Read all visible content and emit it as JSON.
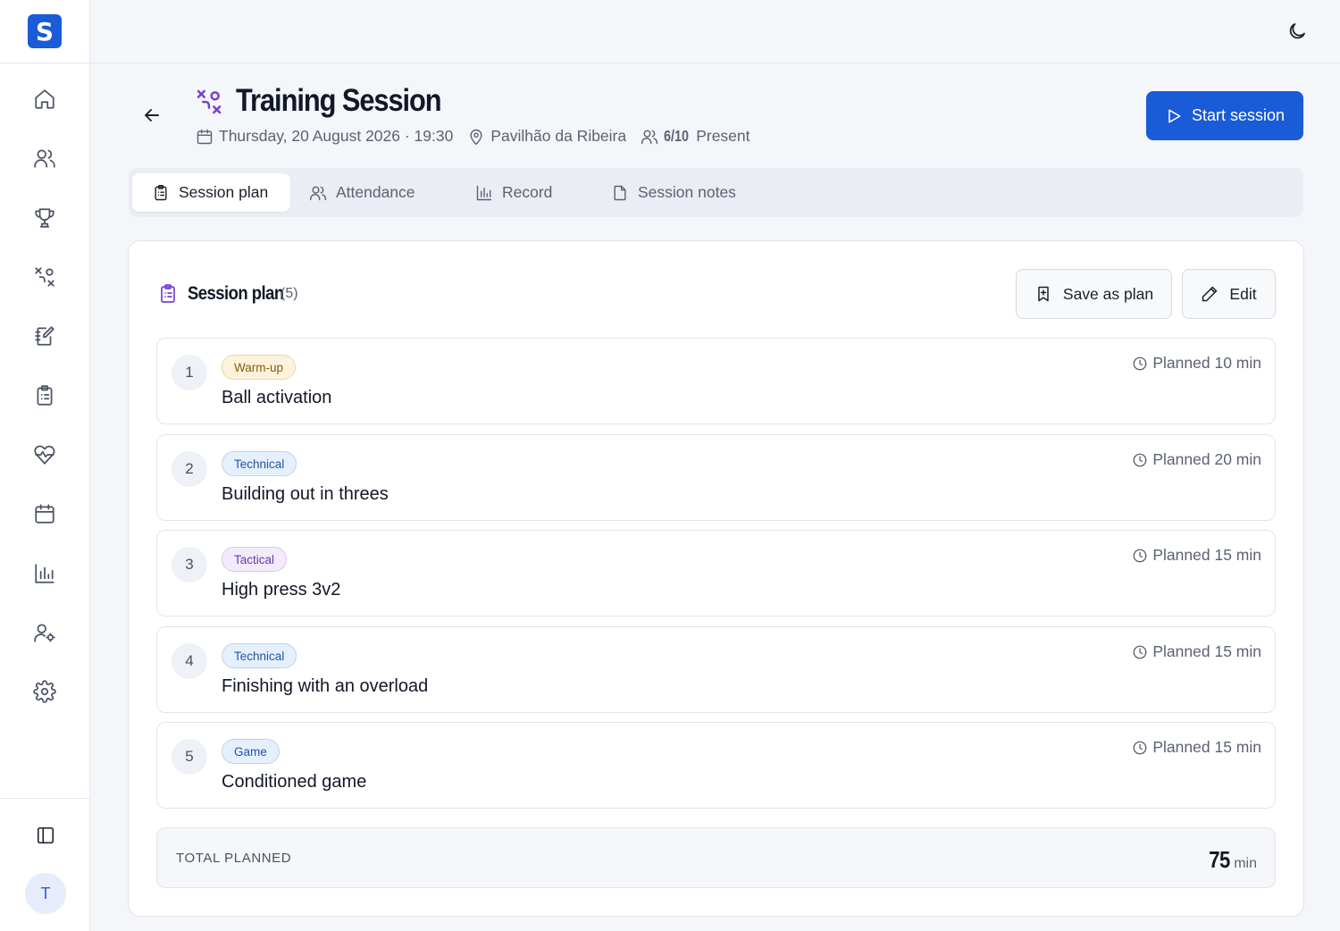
{
  "sidebar": {
    "logo": "S",
    "nav_icons": [
      "home-icon",
      "users-icon",
      "trophy-icon",
      "drills-icon",
      "notebook-icon",
      "clipboard-icon",
      "heart-pulse-icon",
      "calendar-icon",
      "bar-chart-icon",
      "user-settings-icon",
      "gear-icon"
    ],
    "avatar_initial": "T"
  },
  "header": {
    "title": "Training Session",
    "date": "Thursday, 20 August 2026 · 19:30",
    "location": "Pavilhão da Ribeira",
    "attendance_count": "6/10",
    "attendance_label": "Present",
    "start_button": "Start session"
  },
  "tabs": [
    {
      "label": "Session plan",
      "icon": "clipboard-icon",
      "active": true
    },
    {
      "label": "Attendance",
      "icon": "users-icon",
      "active": false
    },
    {
      "label": "Record",
      "icon": "bar-chart-icon",
      "active": false
    },
    {
      "label": "Session notes",
      "icon": "file-icon",
      "active": false
    }
  ],
  "plan": {
    "title": "Session plan",
    "count": "(5)",
    "save_button": "Save as plan",
    "edit_button": "Edit",
    "drills": [
      {
        "number": "1",
        "category": "Warm-up",
        "name": "Ball activation",
        "planned": "Planned 10 min"
      },
      {
        "number": "2",
        "category": "Technical",
        "name": "Building out in threes",
        "planned": "Planned 20 min"
      },
      {
        "number": "3",
        "category": "Tactical",
        "name": "High press 3v2",
        "planned": "Planned 15 min"
      },
      {
        "number": "4",
        "category": "Technical",
        "name": "Finishing with an overload",
        "planned": "Planned 15 min"
      },
      {
        "number": "5",
        "category": "Game",
        "name": "Conditioned game",
        "planned": "Planned 15 min"
      }
    ],
    "total_label": "TOTAL PLANNED",
    "total_value": "75",
    "total_unit": "min"
  },
  "colors": {
    "accent": "#1a5bd8",
    "brand_purple": "#7a3fd1"
  }
}
